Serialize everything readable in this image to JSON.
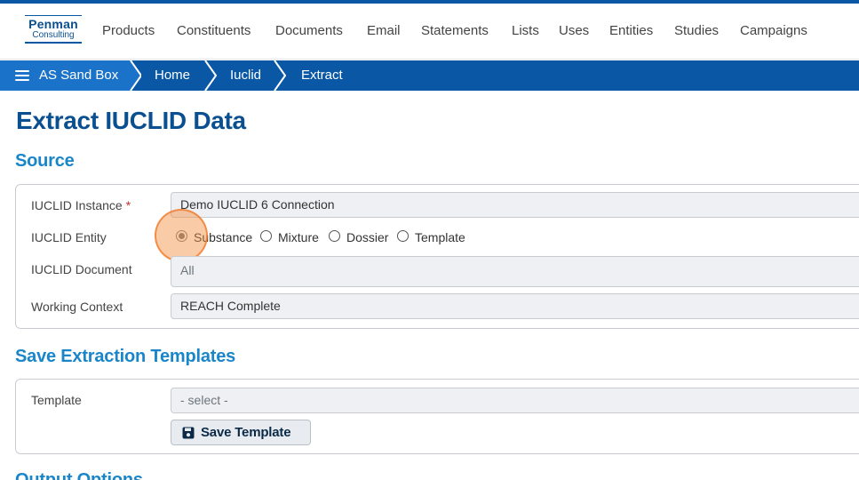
{
  "logo": {
    "line1": "Penman",
    "line2": "Consulting"
  },
  "nav": {
    "items": [
      "Products",
      "Constituents",
      "Documents",
      "Email",
      "Statements",
      "Lists",
      "Uses",
      "Entities",
      "Studies",
      "Campaigns"
    ]
  },
  "breadcrumb": {
    "items": [
      "AS Sand Box",
      "Home",
      "Iuclid",
      "Extract"
    ]
  },
  "page": {
    "title": "Extract IUCLID Data"
  },
  "source": {
    "title": "Source",
    "instance": {
      "label": "IUCLID Instance",
      "required_mark": "*",
      "value": "Demo IUCLID 6 Connection"
    },
    "entity": {
      "label": "IUCLID Entity",
      "options": [
        "Substance",
        "Mixture",
        "Dossier",
        "Template"
      ],
      "selected": "Substance"
    },
    "document": {
      "label": "IUCLID Document",
      "value": "All"
    },
    "context": {
      "label": "Working Context",
      "value": "REACH Complete"
    }
  },
  "templates": {
    "title": "Save Extraction Templates",
    "template": {
      "label": "Template",
      "placeholder": "- select -"
    },
    "save_label": "Save Template"
  },
  "output": {
    "title": "Output Options"
  },
  "colors": {
    "brand": "#0a58a5",
    "title": "#0a4f8f",
    "section": "#1a86c9",
    "highlight": "#f58c3c"
  }
}
